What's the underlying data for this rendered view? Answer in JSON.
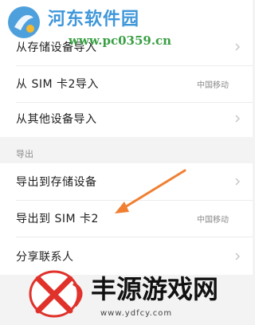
{
  "import_section": {
    "items": [
      {
        "label": "从存储设备导入",
        "value": ""
      },
      {
        "label": "从 SIM 卡2导入",
        "value": "中国移动"
      },
      {
        "label": "从其他设备导入",
        "value": ""
      }
    ]
  },
  "export_section": {
    "title": "导出",
    "items": [
      {
        "label": "导出到存储设备",
        "value": ""
      },
      {
        "label": "导出到 SIM 卡2",
        "value": "中国移动"
      },
      {
        "label": "分享联系人",
        "value": ""
      }
    ]
  },
  "watermark_top": {
    "title": "河东软件园",
    "url": "www.pc0359.cn"
  },
  "watermark_bottom": {
    "title": "丰源游戏网",
    "url": "www.ydfcy.com"
  },
  "colors": {
    "arrow": "#f07f32",
    "accent_blue": "#2f8fd7",
    "accent_green": "#2f9a3a",
    "logo_red": "#e0322b"
  },
  "icons": {
    "row_chevron": "chevron-right-icon"
  }
}
